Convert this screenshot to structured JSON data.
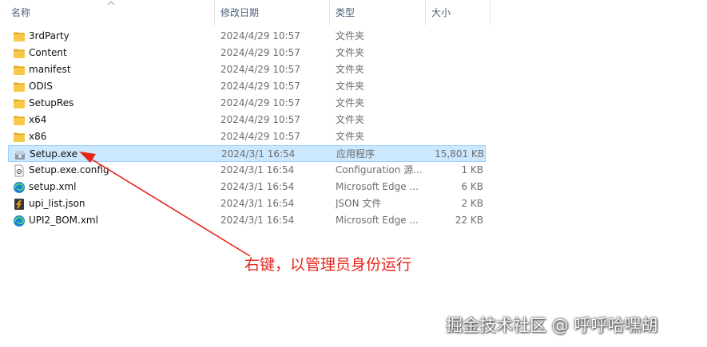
{
  "columns": {
    "name": "名称",
    "date": "修改日期",
    "type": "类型",
    "size": "大小"
  },
  "files": [
    {
      "name": "3rdParty",
      "date": "2024/4/29 10:57",
      "type": "文件夹",
      "size": "",
      "icon": "folder-icon"
    },
    {
      "name": "Content",
      "date": "2024/4/29 10:57",
      "type": "文件夹",
      "size": "",
      "icon": "folder-icon"
    },
    {
      "name": "manifest",
      "date": "2024/4/29 10:57",
      "type": "文件夹",
      "size": "",
      "icon": "folder-icon"
    },
    {
      "name": "ODIS",
      "date": "2024/4/29 10:57",
      "type": "文件夹",
      "size": "",
      "icon": "folder-icon"
    },
    {
      "name": "SetupRes",
      "date": "2024/4/29 10:57",
      "type": "文件夹",
      "size": "",
      "icon": "folder-icon"
    },
    {
      "name": "x64",
      "date": "2024/4/29 10:57",
      "type": "文件夹",
      "size": "",
      "icon": "folder-icon"
    },
    {
      "name": "x86",
      "date": "2024/4/29 10:57",
      "type": "文件夹",
      "size": "",
      "icon": "folder-icon"
    },
    {
      "name": "Setup.exe",
      "date": "2024/3/1 16:54",
      "type": "应用程序",
      "size": "15,801 KB",
      "icon": "setup-exe-icon",
      "selected": true
    },
    {
      "name": "Setup.exe.config",
      "date": "2024/3/1 16:54",
      "type": "Configuration 源...",
      "size": "1 KB",
      "icon": "config-file-icon"
    },
    {
      "name": "setup.xml",
      "date": "2024/3/1 16:54",
      "type": "Microsoft Edge ...",
      "size": "6 KB",
      "icon": "edge-icon"
    },
    {
      "name": "upi_list.json",
      "date": "2024/3/1 16:54",
      "type": "JSON 文件",
      "size": "2 KB",
      "icon": "json-file-icon"
    },
    {
      "name": "UPI2_BOM.xml",
      "date": "2024/3/1 16:54",
      "type": "Microsoft Edge ...",
      "size": "22 KB",
      "icon": "edge-icon"
    }
  ],
  "annotation": "右键，以管理员身份运行",
  "watermark": "掘金技术社区 @ 呼呼哈嘿胡",
  "colors": {
    "annotation": "#e8251a",
    "selection": "#cce8ff",
    "folder": "#f8c948"
  }
}
